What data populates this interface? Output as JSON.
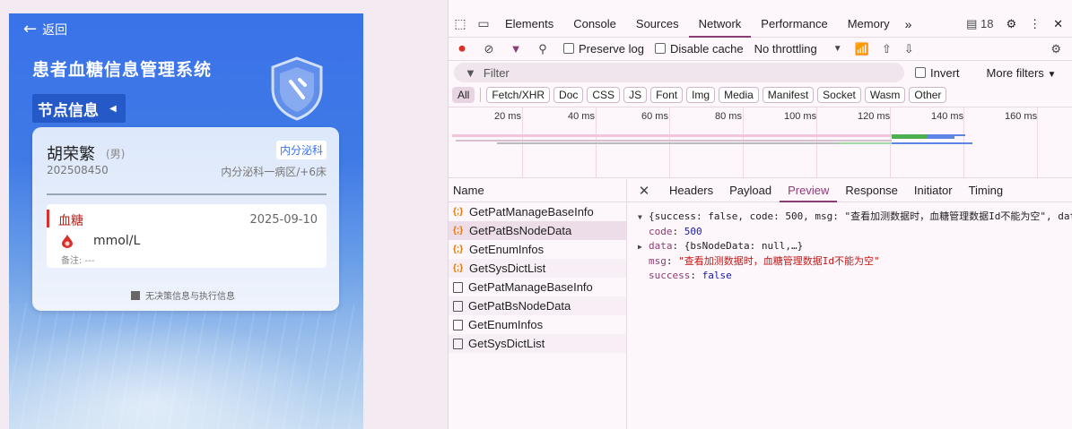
{
  "app": {
    "back_label": "返回",
    "title": "患者血糖信息管理系统",
    "node_tab": "节点信息",
    "patient": {
      "name": "胡荣繁",
      "gender": "(男)",
      "dept_badge": "内分泌科",
      "id": "202508450",
      "bed": "内分泌科一病区/+6床"
    },
    "record": {
      "title": "血糖",
      "date": "2025-09-10",
      "unit": "mmol/L",
      "remark": "备注: ---"
    },
    "no_decision": "无决策信息与执行信息"
  },
  "devtools": {
    "tabs": [
      "Elements",
      "Console",
      "Sources",
      "Network",
      "Performance",
      "Memory"
    ],
    "active_tab": "Network",
    "issues_count": "18",
    "toolbar": {
      "preserve_log": "Preserve log",
      "disable_cache": "Disable cache",
      "throttling": "No throttling"
    },
    "filter": {
      "placeholder": "Filter",
      "invert": "Invert",
      "more_filters": "More filters"
    },
    "types": [
      "All",
      "Fetch/XHR",
      "Doc",
      "CSS",
      "JS",
      "Font",
      "Img",
      "Media",
      "Manifest",
      "Socket",
      "Wasm",
      "Other"
    ],
    "timeline_ticks": [
      "20 ms",
      "40 ms",
      "60 ms",
      "80 ms",
      "100 ms",
      "120 ms",
      "140 ms",
      "160 ms"
    ],
    "name_header": "Name",
    "requests": [
      {
        "name": "GetPatManageBaseInfo",
        "kind": "xhr"
      },
      {
        "name": "GetPatBsNodeData",
        "kind": "xhr"
      },
      {
        "name": "GetEnumInfos",
        "kind": "xhr"
      },
      {
        "name": "GetSysDictList",
        "kind": "xhr"
      },
      {
        "name": "GetPatManageBaseInfo",
        "kind": "doc"
      },
      {
        "name": "GetPatBsNodeData",
        "kind": "doc"
      },
      {
        "name": "GetEnumInfos",
        "kind": "doc"
      },
      {
        "name": "GetSysDictList",
        "kind": "doc"
      }
    ],
    "detail_tabs": [
      "Headers",
      "Payload",
      "Preview",
      "Response",
      "Initiator",
      "Timing"
    ],
    "active_detail_tab": "Preview",
    "preview": {
      "summary": "{success: false, code: 500, msg: \"查看加测数据时，血糖管理数据Id不能为空\", dat",
      "code_key": "code",
      "code_val": "500",
      "data_key": "data",
      "data_val": "{bsNodeData: null,…}",
      "msg_key": "msg",
      "msg_val": "\"查看加测数据时，血糖管理数据Id不能为空\"",
      "success_key": "success",
      "success_val": "false"
    }
  }
}
